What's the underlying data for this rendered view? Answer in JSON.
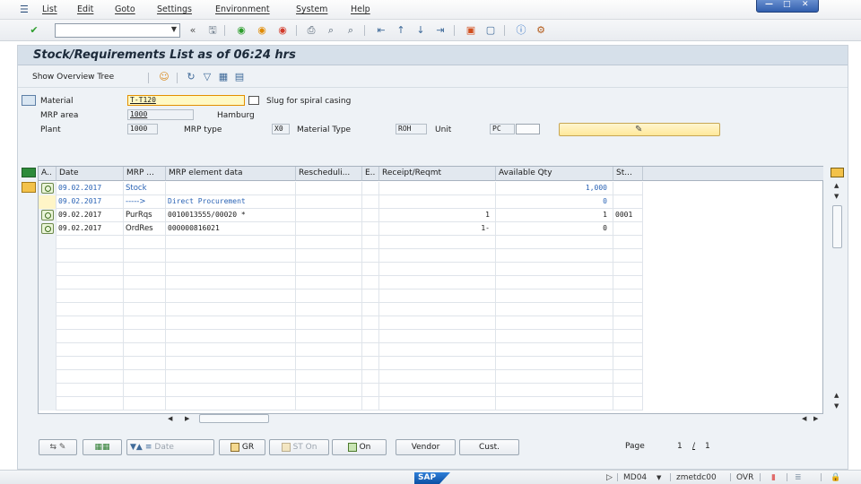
{
  "menu": [
    "List",
    "Edit",
    "Goto",
    "Settings",
    "Environment",
    "System",
    "Help"
  ],
  "toolbar": {
    "command_value": "",
    "back_glyph": "«"
  },
  "window_title": "Stock/Requirements List as of 06:24 hrs",
  "app_toolbar": {
    "show_overview_tree": "Show Overview Tree"
  },
  "header": {
    "material_label": "Material",
    "material_value": "T-T120",
    "material_desc": "Slug for spiral casing",
    "mrp_area_label": "MRP area",
    "mrp_area_value": "1000",
    "mrp_area_desc": "Hamburg",
    "plant_label": "Plant",
    "plant_value": "1000",
    "mrp_type_label": "MRP type",
    "mrp_type_value": "X0",
    "material_type_label": "Material Type",
    "material_type_value": "ROH",
    "unit_label": "Unit",
    "unit_value": "PC"
  },
  "table": {
    "columns": [
      "A..",
      "Date",
      "MRP ...",
      "MRP element data",
      "Rescheduli...",
      "E..",
      "Receipt/Reqmt",
      "Available Qty",
      "St..."
    ],
    "rows": [
      {
        "date": "09.02.2017",
        "mrp_element": "Stock",
        "element_data": "",
        "reschedule": "",
        "e": "",
        "receipt": "",
        "available": "1,000",
        "storage": "",
        "style": "blue",
        "icon": "detail-icon"
      },
      {
        "date": "09.02.2017",
        "mrp_element": "----->",
        "element_data": "Direct Procurement",
        "reschedule": "",
        "e": "",
        "receipt": "",
        "available": "0",
        "storage": "",
        "style": "blue",
        "icon": ""
      },
      {
        "date": "09.02.2017",
        "mrp_element": "PurRqs",
        "element_data": "0010013555/00020 *",
        "reschedule": "",
        "e": "",
        "receipt": "1",
        "available": "1",
        "storage": "0001",
        "style": "normal",
        "icon": "detail-icon"
      },
      {
        "date": "09.02.2017",
        "mrp_element": "OrdRes",
        "element_data": "000000816021",
        "reschedule": "",
        "e": "",
        "receipt": "1-",
        "available": "0",
        "storage": "",
        "style": "normal",
        "icon": "detail-icon"
      }
    ]
  },
  "bottom_buttons": {
    "date": "Date",
    "gr": "GR",
    "st_on": "ST On",
    "on": "On",
    "vendor": "Vendor",
    "cust": "Cust."
  },
  "pager": {
    "label": "Page",
    "current": "1",
    "sep": "/",
    "total": "1"
  },
  "statusbar": {
    "transaction": "MD04",
    "user": "zmetdc00",
    "mode": "OVR"
  },
  "colors": {
    "frame_bg": "#eef2f6",
    "title_bg": "#d6e0ea",
    "highlight_field": "#fff9c4",
    "link_blue": "#2a63b5"
  }
}
